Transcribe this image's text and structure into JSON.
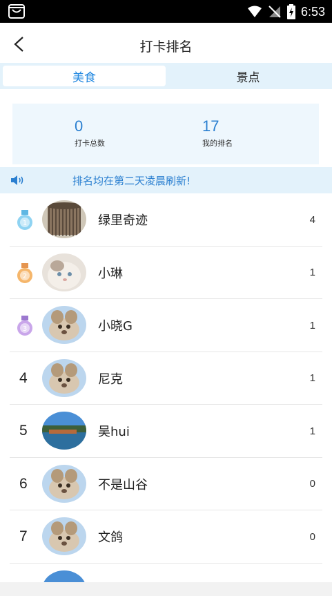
{
  "status_bar": {
    "time": "6:53"
  },
  "header": {
    "title": "打卡排名",
    "back_icon": "chevron-left-icon"
  },
  "tabs": [
    {
      "label": "美食",
      "active": true
    },
    {
      "label": "景点",
      "active": false
    }
  ],
  "stats": {
    "total_value": "0",
    "total_label": "打卡总数",
    "rank_value": "17",
    "rank_label": "我的排名"
  },
  "notice": {
    "text": "排名均在第二天凌晨刷新!",
    "icon": "speaker-icon"
  },
  "colors": {
    "accent": "#2a7fd0",
    "tab_bg": "#e3f2fb",
    "stats_bg": "#eef7fd"
  },
  "ranking": [
    {
      "rank": "1",
      "medal": "blue",
      "name": "绿里奇迹",
      "count": "4",
      "avatar": "birdcage-photo"
    },
    {
      "rank": "2",
      "medal": "orange",
      "name": "小琳",
      "count": "1",
      "avatar": "cat-photo"
    },
    {
      "rank": "3",
      "medal": "purple",
      "name": "小晓G",
      "count": "1",
      "avatar": "default-avatar"
    },
    {
      "rank": "4",
      "medal": "",
      "name": "尼克",
      "count": "1",
      "avatar": "default-avatar"
    },
    {
      "rank": "5",
      "medal": "",
      "name": "吴hui",
      "count": "1",
      "avatar": "landscape-photo"
    },
    {
      "rank": "6",
      "medal": "",
      "name": "不是山谷",
      "count": "0",
      "avatar": "default-avatar"
    },
    {
      "rank": "7",
      "medal": "",
      "name": "文鸽",
      "count": "0",
      "avatar": "default-avatar"
    }
  ]
}
